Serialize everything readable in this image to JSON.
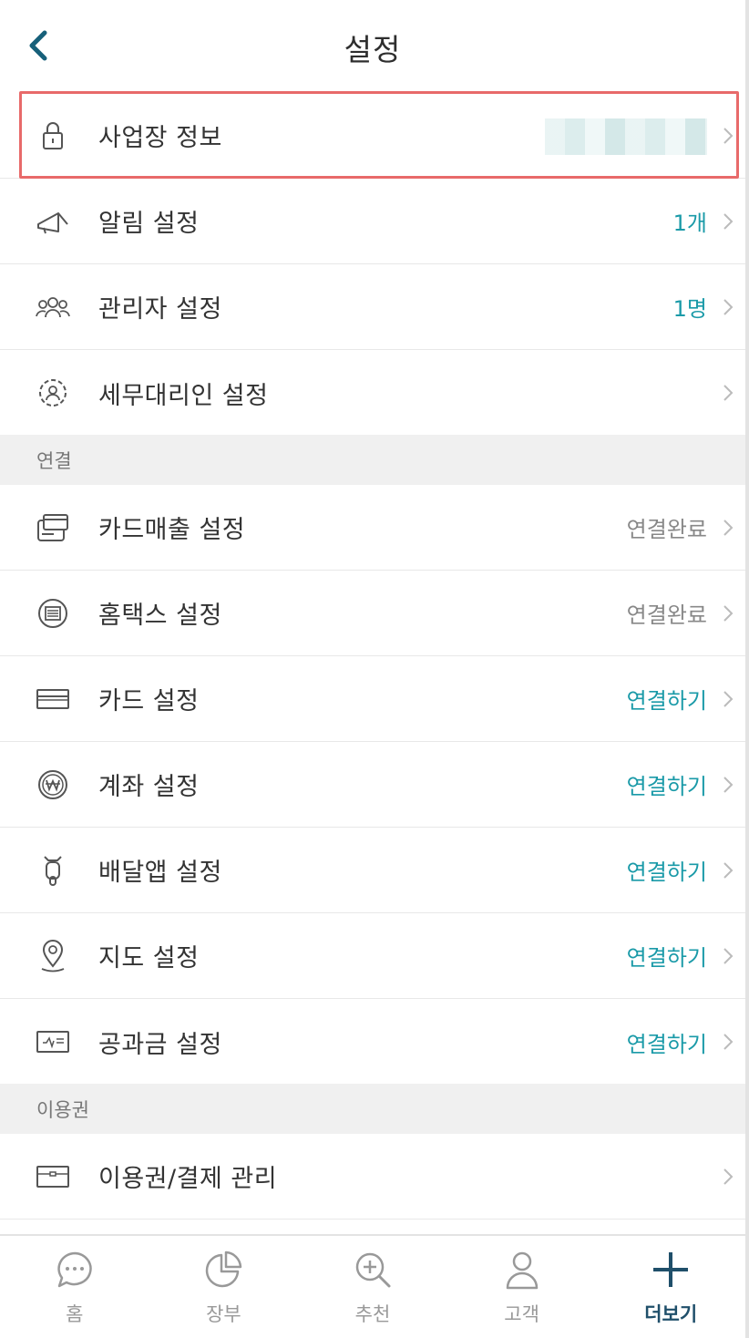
{
  "header": {
    "title": "설정"
  },
  "rows": {
    "business_info": {
      "label": "사업장 정보"
    },
    "notifications": {
      "label": "알림 설정",
      "value": "1개"
    },
    "admins": {
      "label": "관리자 설정",
      "value": "1명"
    },
    "tax_agent": {
      "label": "세무대리인 설정"
    },
    "card_sales": {
      "label": "카드매출 설정",
      "value": "연결완료"
    },
    "hometax": {
      "label": "홈택스 설정",
      "value": "연결완료"
    },
    "card": {
      "label": "카드 설정",
      "value": "연결하기"
    },
    "account": {
      "label": "계좌 설정",
      "value": "연결하기"
    },
    "delivery": {
      "label": "배달앱 설정",
      "value": "연결하기"
    },
    "map": {
      "label": "지도 설정",
      "value": "연결하기"
    },
    "utility": {
      "label": "공과금 설정",
      "value": "연결하기"
    },
    "subscription": {
      "label": "이용권/결제 관리"
    }
  },
  "sections": {
    "connection": "연결",
    "subscription": "이용권"
  },
  "tabbar": {
    "home": "홈",
    "ledger": "장부",
    "recommend": "추천",
    "customers": "고객",
    "more": "더보기"
  },
  "colors": {
    "accent": "#1a9aa8",
    "highlight": "#e86a6a",
    "active_tab": "#1f4f6a"
  },
  "icons": [
    "chevron-left-icon",
    "lock-icon",
    "megaphone-icon",
    "people-icon",
    "gear-person-icon",
    "card-terminal-icon",
    "document-circle-icon",
    "card-icon",
    "won-coin-icon",
    "scooter-icon",
    "map-pin-icon",
    "bill-icon",
    "ticket-icon",
    "chat-bubble-icon",
    "pie-chart-icon",
    "zoom-plus-icon",
    "person-icon",
    "plus-icon"
  ]
}
